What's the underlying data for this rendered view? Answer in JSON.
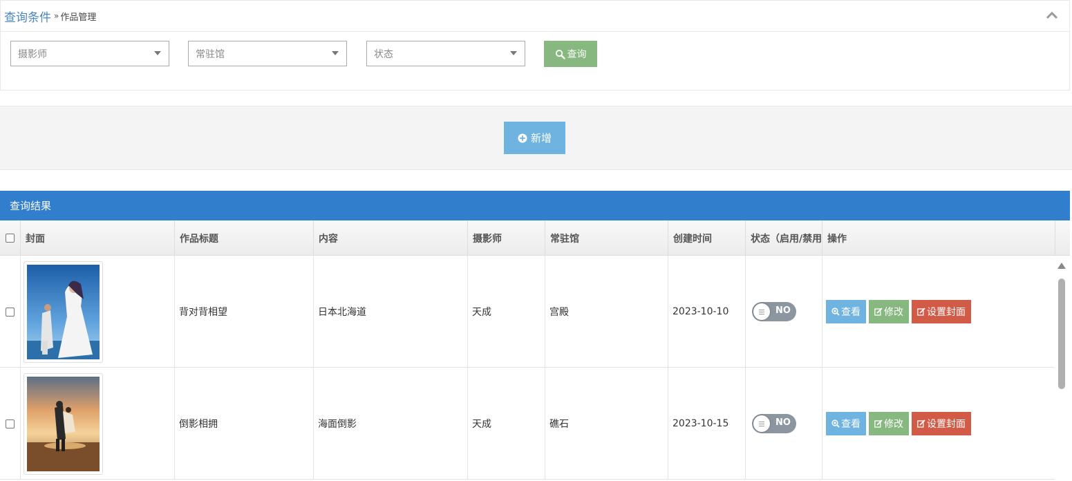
{
  "query": {
    "title": "查询条件",
    "breadcrumb_sep": "»",
    "breadcrumb": "作品管理",
    "photographer_placeholder": "摄影师",
    "studio_placeholder": "常驻馆",
    "status_placeholder": "状态",
    "search_label": "查询"
  },
  "toolbar": {
    "add_label": "新增"
  },
  "results": {
    "title": "查询结果",
    "columns": [
      "封面",
      "作品标题",
      "内容",
      "摄影师",
      "常驻馆",
      "创建时间",
      "状态（启用/禁用）",
      "操作"
    ],
    "rows": [
      {
        "title": "背对背相望",
        "content": "日本北海道",
        "photographer": "天成",
        "studio": "宫殿",
        "created": "2023-10-10",
        "status": "NO"
      },
      {
        "title": "倒影相拥",
        "content": "海面倒影",
        "photographer": "天成",
        "studio": "礁石",
        "created": "2023-10-15",
        "status": "NO"
      }
    ],
    "actions": {
      "view": "查看",
      "edit": "修改",
      "cover": "设置封面"
    }
  },
  "colors": {
    "primary": "#307ecc",
    "link": "#4a86c5",
    "success": "#87b87f",
    "info": "#6fb3e0",
    "danger": "#d15b47",
    "toggle_off": "#8c96a0"
  }
}
